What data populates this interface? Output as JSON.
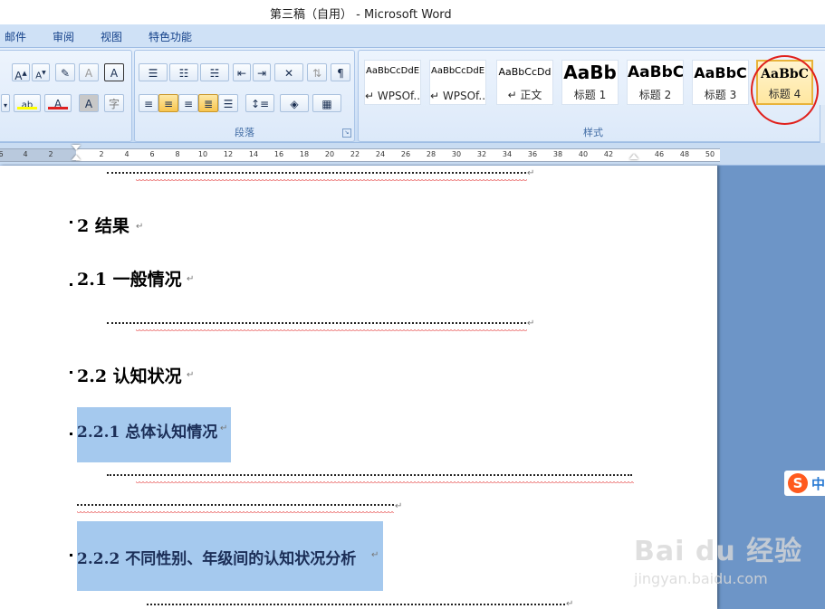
{
  "window": {
    "title": "第三稿（自用） - Microsoft Word"
  },
  "tabs": [
    "邮件",
    "审阅",
    "视图",
    "特色功能"
  ],
  "ribbon": {
    "font_group": {
      "grow_font": "A",
      "shrink_font": "A",
      "phonetic": "A",
      "char_border": "A",
      "font_color": "A",
      "char_shading": "A",
      "enclose_char": "字"
    },
    "paragraph_group": {
      "label": "段落"
    },
    "styles_group": {
      "label": "样式",
      "styles": [
        {
          "sample": "AaBbCcDdE",
          "name": "↵ WPSOf..."
        },
        {
          "sample": "AaBbCcDdE",
          "name": "↵ WPSOf..."
        },
        {
          "sample": "AaBbCcDd",
          "name": "↵ 正文"
        },
        {
          "sample": "AaBb",
          "name": "标题 1"
        },
        {
          "sample": "AaBbC",
          "name": "标题 2"
        },
        {
          "sample": "AaBbC",
          "name": "标题 3"
        },
        {
          "sample": "AaBbC",
          "name": "标题 4"
        }
      ],
      "selected_style": "标题 4"
    }
  },
  "ruler": {
    "numbers": [
      "6",
      "4",
      "2",
      "2",
      "4",
      "6",
      "8",
      "10",
      "12",
      "14",
      "16",
      "18",
      "20",
      "22",
      "24",
      "26",
      "28",
      "30",
      "32",
      "34",
      "36",
      "38",
      "40",
      "42",
      "46",
      "48",
      "50"
    ]
  },
  "document": {
    "paragraph_mark": "↵",
    "h_results": "2  结果",
    "h_general": "2.1 一般情况",
    "h_cognition": "2.2 认知状况",
    "h_overall": "2.2.1 总体认知情况",
    "h_gender_grade": "2.2.2 不同性别、年级间的认知状况分析"
  },
  "watermark": {
    "logo": "Bai du 经验",
    "url": "jingyan.baidu.com"
  },
  "ime": {
    "logo": "S",
    "mode": "中"
  },
  "colors": {
    "annotation_circle": "#e0201c",
    "selection": "#a5c9ee",
    "spellcheck": "#e02020"
  }
}
